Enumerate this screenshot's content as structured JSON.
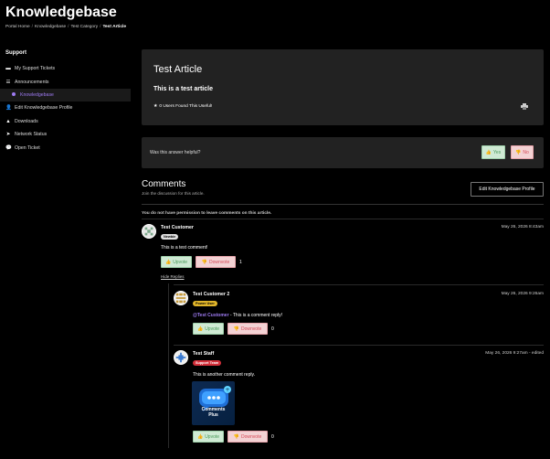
{
  "page": {
    "title": "Knowledgebase"
  },
  "breadcrumbs": [
    "Portal Home",
    "Knowledgebase",
    "Test Category",
    "Test Article"
  ],
  "sidebar": {
    "heading": "Support",
    "items": [
      {
        "label": "My Support Tickets",
        "icon": "tickets-icon"
      },
      {
        "label": "Announcements",
        "icon": "list-icon"
      },
      {
        "label": "Knowledgebase",
        "icon": "dot-icon",
        "active": true
      },
      {
        "label": "Edit Knowledgebase Profile",
        "icon": "user-edit-icon"
      },
      {
        "label": "Downloads",
        "icon": "download-icon"
      },
      {
        "label": "Network Status",
        "icon": "send-icon"
      },
      {
        "label": "Open Ticket",
        "icon": "comments-icon"
      }
    ]
  },
  "article": {
    "title": "Test Article",
    "body": "This is a test article",
    "useful": "0 Users Found This Useful!"
  },
  "helpful": {
    "question": "Was this answer helpful?",
    "yes": "Yes",
    "no": "No"
  },
  "comments": {
    "heading": "Comments",
    "subheading": "Join the discussion for this article.",
    "edit_profile_button": "Edit Knowledgebase Profile",
    "no_permission": "You do not have permission to leave comments on this article.",
    "upvote_label": "Upvote",
    "downvote_label": "Downvote",
    "hide_replies": "Hide Replies",
    "items": [
      {
        "author": "Test Customer",
        "badge": "Newbie",
        "date": "May 26, 2026 8:43am",
        "text": "This is a test comment!",
        "score": "1"
      },
      {
        "author": "Test Customer 2",
        "badge": "Power User",
        "date": "May 26, 2026 9:26am",
        "mention": "@Test Customer",
        "text": " - This is a comment reply!",
        "score": "0"
      },
      {
        "author": "Test Staff",
        "badge": "Support Team",
        "date": "May 26, 2026 9:27am - edited",
        "text": "This is another comment reply.",
        "score": "0"
      }
    ]
  },
  "plugin_image": {
    "line1": "Comments",
    "line2": "Plus"
  },
  "colors": {
    "accent": "#9e7bf2",
    "upvote_bg": "#cfead4",
    "downvote_bg": "#f3d2d4",
    "staff_badge": "#d32f3a",
    "power_badge": "#e1b52a"
  }
}
